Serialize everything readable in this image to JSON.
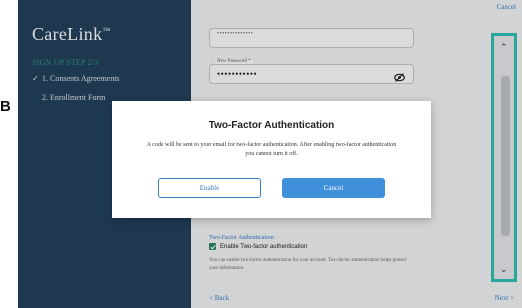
{
  "label_letter": "B",
  "brand": {
    "name": "CareLink",
    "mark": "™"
  },
  "sidebar": {
    "step_header": "SIGN UP STEP 2/3",
    "steps": [
      {
        "label": "1. Consents Agreements",
        "done": true
      },
      {
        "label": "2. Enrollment Form",
        "done": false
      }
    ]
  },
  "header": {
    "cancel_label": "Cancel"
  },
  "form": {
    "username_value": "••••••••••••••",
    "new_password_label": "New Password *",
    "new_password_value": "•••••••••••",
    "tfa_header": "Two-Factor Authentication",
    "tfa_checkbox_label": "Enable Two-factor authentication",
    "tfa_checked": true,
    "tfa_help": "You can enable two-factor authentication for your account. Two-factor authentication helps protect your information."
  },
  "nav": {
    "back_label": "< Back",
    "next_label": "Next >"
  },
  "modal": {
    "title": "Two-Factor Authentication",
    "description": "A code will be sent to your email for two-factor authentication. After enabling two-factor authentication you cannot turn it off.",
    "enable_label": "Enable",
    "cancel_label": "Cancel"
  },
  "scrollbar": {
    "up_glyph": "⌃",
    "down_glyph": "⌄"
  },
  "colors": {
    "sidebar_bg": "#24425e",
    "step_header": "#2d9a78",
    "accent": "#3a7bc8",
    "primary_button": "#3f8fdb",
    "highlight": "#2ec4b6"
  }
}
